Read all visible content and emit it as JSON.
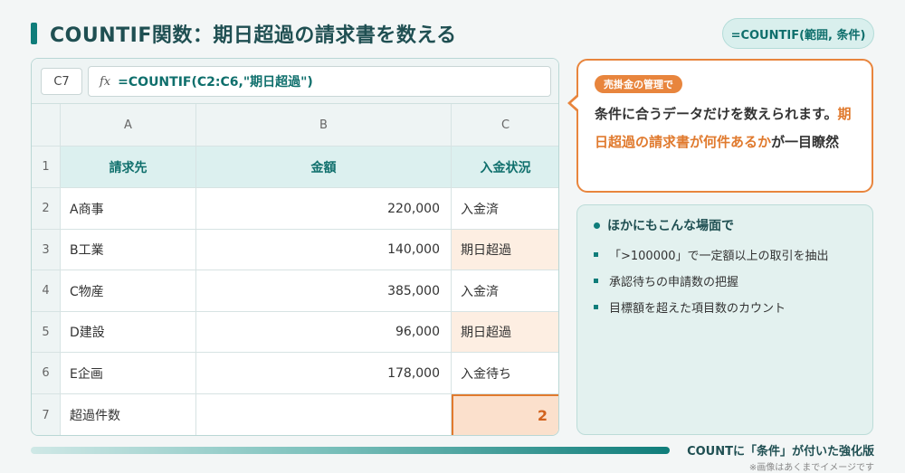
{
  "header": {
    "title": "COUNTIF関数：期日超過の請求書を数える",
    "formula_badge": "=COUNTIF(範囲, 条件)"
  },
  "formula_bar": {
    "name_box": "C7",
    "fx_label": "fx",
    "formula": "=COUNTIF(C2:C6,\"期日超過\")"
  },
  "sheet": {
    "column_headers": [
      "A",
      "B",
      "C"
    ],
    "row_numbers": [
      "1",
      "2",
      "3",
      "4",
      "5",
      "6",
      "7"
    ],
    "header_row": [
      "請求先",
      "金額",
      "入金状況"
    ],
    "rows": [
      {
        "client": "A商事",
        "amount": "220,000",
        "status": "入金済"
      },
      {
        "client": "B工業",
        "amount": "140,000",
        "status": "期日超過"
      },
      {
        "client": "C物産",
        "amount": "385,000",
        "status": "入金済"
      },
      {
        "client": "D建設",
        "amount": "96,000",
        "status": "期日超過"
      },
      {
        "client": "E企画",
        "amount": "178,000",
        "status": "入金待ち"
      }
    ],
    "total_row": {
      "label": "超過件数",
      "result": "2"
    }
  },
  "callout": {
    "tag": "売掛金の管理で",
    "text_part1": "条件に合うデータだけを数えられます。",
    "text_emphasis": "期日超過の請求書が何件あるか",
    "text_part2": "が一目瞭然"
  },
  "tips": {
    "title": "ほかにもこんな場面で",
    "items": [
      "「>100000」で一定額以上の取引を抽出",
      "承認待ちの申請数の把握",
      "目標額を超えた項目数のカウント"
    ]
  },
  "footer": {
    "caption": "COUNTに「条件」が付いた強化版",
    "note": "※画像はあくまでイメージです"
  },
  "colors": {
    "accent": "#0f7d7a",
    "highlight": "#e07a2e"
  }
}
